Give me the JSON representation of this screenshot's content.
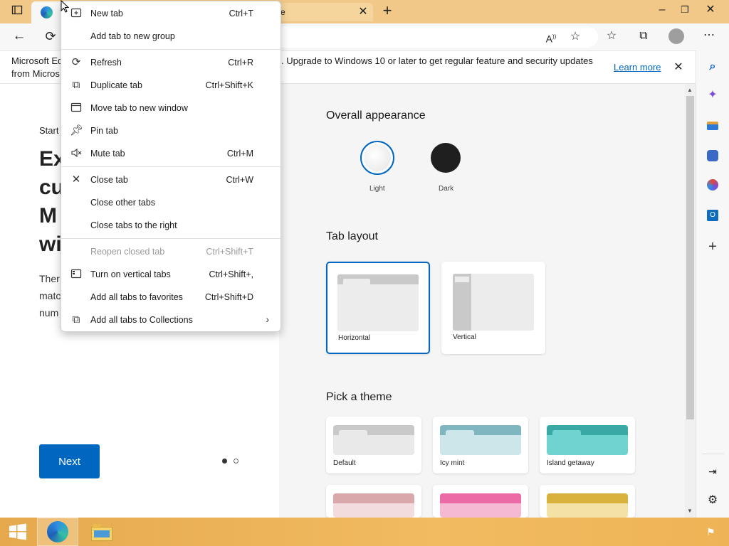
{
  "tabs": {
    "tab2_fragment": "e"
  },
  "infobar": {
    "line1_left": "Microsoft Ed",
    "line2_left": "from Micros",
    "line1_right": ". Upgrade to Windows 10 or later to get regular feature and security updates",
    "learn_more": "Learn more"
  },
  "left": {
    "start_label": "Start",
    "heading_lines": [
      "Ex",
      "cu",
      "M",
      "wi"
    ],
    "body_lines": [
      "Ther",
      "matc",
      "num"
    ],
    "next_button": "Next"
  },
  "settings": {
    "overall_appearance": "Overall appearance",
    "appearance_options": [
      "Light",
      "Dark"
    ],
    "tab_layout": "Tab layout",
    "layout_options": [
      "Horizontal",
      "Vertical"
    ],
    "pick_theme": "Pick a theme",
    "themes": [
      "Default",
      "Icy mint",
      "Island getaway"
    ]
  },
  "menu": {
    "items": [
      {
        "label": "New tab",
        "shortcut": "Ctrl+T",
        "icon": "new-tab-icon"
      },
      {
        "label": "Add tab to new group",
        "shortcut": "",
        "icon": ""
      },
      {
        "label": "Refresh",
        "shortcut": "Ctrl+R",
        "icon": "refresh-icon"
      },
      {
        "label": "Duplicate tab",
        "shortcut": "Ctrl+Shift+K",
        "icon": "duplicate-icon"
      },
      {
        "label": "Move tab to new window",
        "shortcut": "",
        "icon": "window-icon"
      },
      {
        "label": "Pin tab",
        "shortcut": "",
        "icon": "pin-icon"
      },
      {
        "label": "Mute tab",
        "shortcut": "Ctrl+M",
        "icon": "mute-icon"
      },
      {
        "label": "Close tab",
        "shortcut": "Ctrl+W",
        "icon": "close-icon"
      },
      {
        "label": "Close other tabs",
        "shortcut": "",
        "icon": ""
      },
      {
        "label": "Close tabs to the right",
        "shortcut": "",
        "icon": ""
      },
      {
        "label": "Reopen closed tab",
        "shortcut": "Ctrl+Shift+T",
        "icon": ""
      },
      {
        "label": "Turn on vertical tabs",
        "shortcut": "Ctrl+Shift+,",
        "icon": "vertical-tabs-icon"
      },
      {
        "label": "Add all tabs to favorites",
        "shortcut": "Ctrl+Shift+D",
        "icon": ""
      },
      {
        "label": "Add all tabs to Collections",
        "shortcut": "",
        "icon": "collections-icon"
      }
    ]
  },
  "colors": {
    "accent": "#0067c0",
    "titlebar": "#f2c889",
    "taskbar": "#eeb355"
  }
}
